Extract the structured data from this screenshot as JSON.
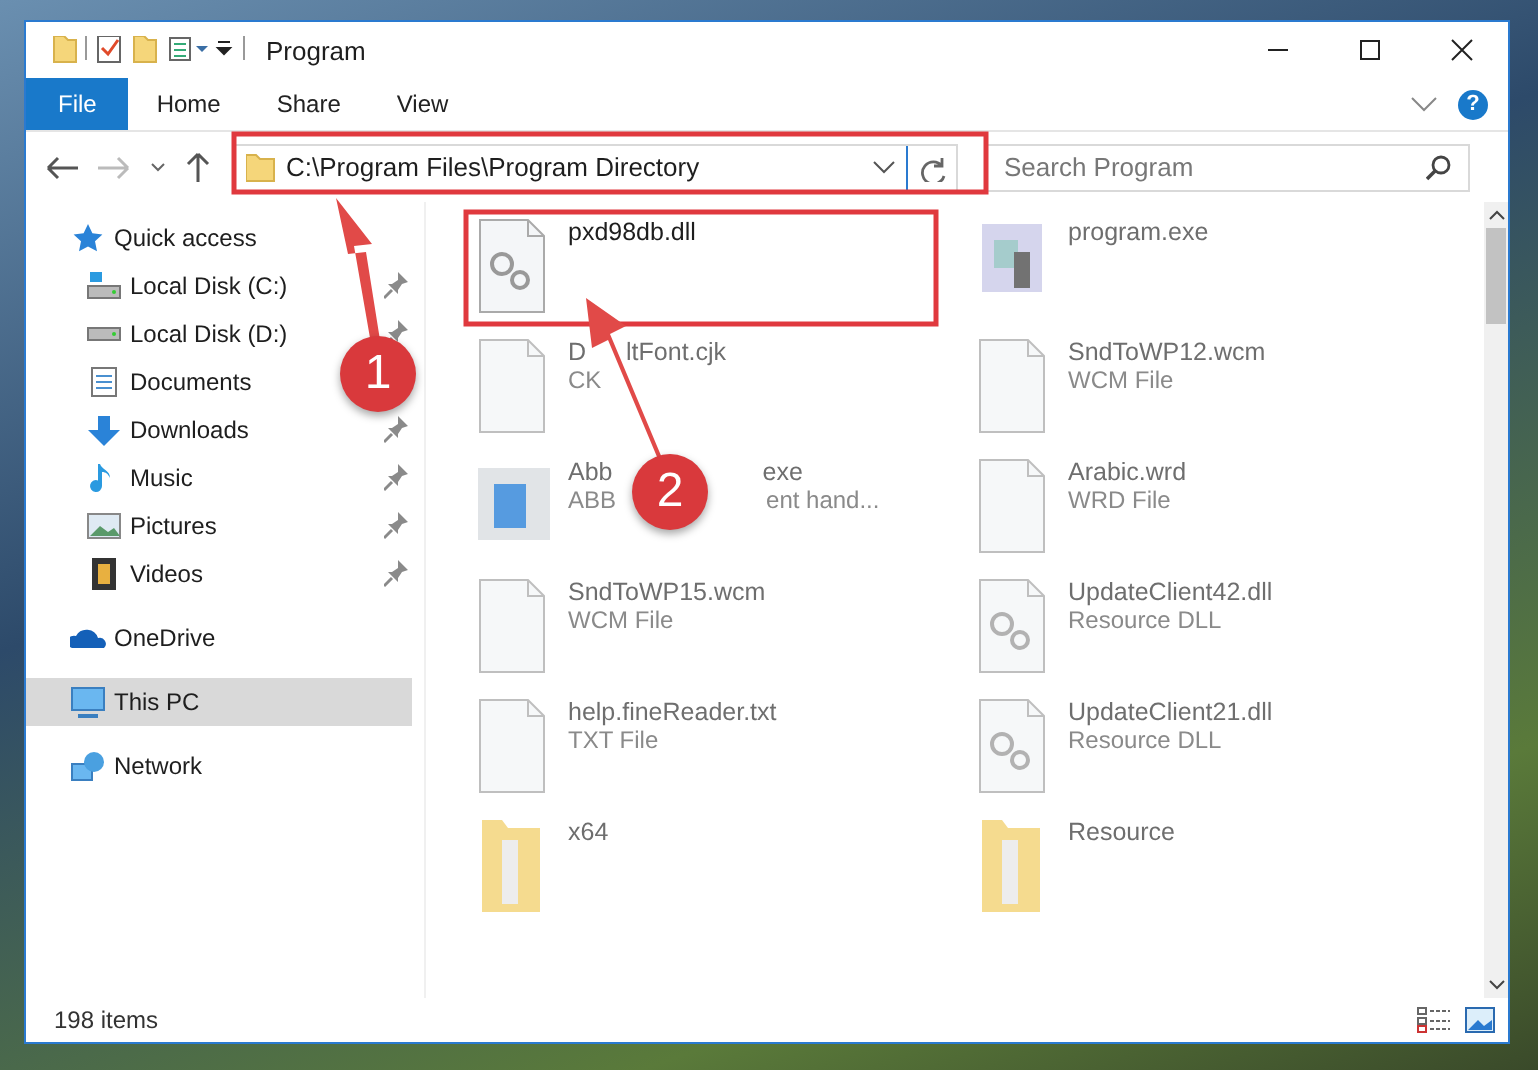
{
  "window": {
    "title": "Program"
  },
  "ribbon": {
    "tabs": [
      {
        "label": "File",
        "selected": true
      },
      {
        "label": "Home",
        "selected": false
      },
      {
        "label": "Share",
        "selected": false
      },
      {
        "label": "View",
        "selected": false
      }
    ],
    "help": "?"
  },
  "address_bar": {
    "path": "C:\\Program Files\\Program Directory"
  },
  "search": {
    "placeholder": "Search Program"
  },
  "sidebar": {
    "items": [
      {
        "label": "Quick access",
        "kind": "star",
        "selected": false,
        "children": [
          {
            "label": "Local Disk (C:)",
            "kind": "drive-win",
            "pinned": true
          },
          {
            "label": "Local Disk (D:)",
            "kind": "drive",
            "pinned": true
          },
          {
            "label": "Documents",
            "kind": "documents"
          },
          {
            "label": "Downloads",
            "kind": "downloads",
            "pinned": true
          },
          {
            "label": "Music",
            "kind": "music",
            "pinned": true
          },
          {
            "label": "Pictures",
            "kind": "pictures",
            "pinned": true
          },
          {
            "label": "Videos",
            "kind": "videos",
            "pinned": true
          }
        ]
      },
      {
        "label": "OneDrive",
        "kind": "cloud",
        "selected": false
      },
      {
        "label": "This PC",
        "kind": "pc",
        "selected": true
      },
      {
        "label": "Network",
        "kind": "network",
        "selected": false
      }
    ]
  },
  "files": [
    {
      "name": [
        "pxd98db.dll"
      ],
      "kind": "gear-doc",
      "blurred": false
    },
    {
      "name": [
        "program.exe"
      ],
      "kind": "exe",
      "blurred": true
    },
    {
      "name": [
        "D",
        "ltFont.cjk"
      ],
      "type": [
        "CK"
      ],
      "kind": "doc",
      "blurred": true
    },
    {
      "name": [
        "SndToWP12.wcm"
      ],
      "type": [
        "WCM File"
      ],
      "kind": "doc",
      "blurred": true
    },
    {
      "name": [
        "Abb",
        "exe"
      ],
      "type": [
        "ABB",
        "ent hand..."
      ],
      "kind": "app",
      "blurred": true
    },
    {
      "name": [
        "Arabic.wrd"
      ],
      "type": [
        "WRD File"
      ],
      "kind": "doc",
      "blurred": true
    },
    {
      "name": [
        "SndToWP15.wcm"
      ],
      "type": [
        "WCM File"
      ],
      "kind": "doc",
      "blurred": true
    },
    {
      "name": [
        "UpdateClient42.dll"
      ],
      "type": [
        "Resource DLL"
      ],
      "kind": "gear-doc",
      "blurred": true
    },
    {
      "name": [
        "help.fineReader.txt"
      ],
      "type": [
        "TXT File"
      ],
      "kind": "doc",
      "blurred": true
    },
    {
      "name": [
        "UpdateClient21.dll"
      ],
      "type": [
        "Resource DLL"
      ],
      "kind": "gear-doc",
      "blurred": true
    },
    {
      "name": [
        "x64"
      ],
      "kind": "folder",
      "blurred": true
    },
    {
      "name": [
        "Resource"
      ],
      "kind": "folder",
      "blurred": true
    }
  ],
  "status_bar": {
    "item_count": "198 items"
  },
  "annotations": [
    {
      "label": "1"
    },
    {
      "label": "2"
    }
  ]
}
